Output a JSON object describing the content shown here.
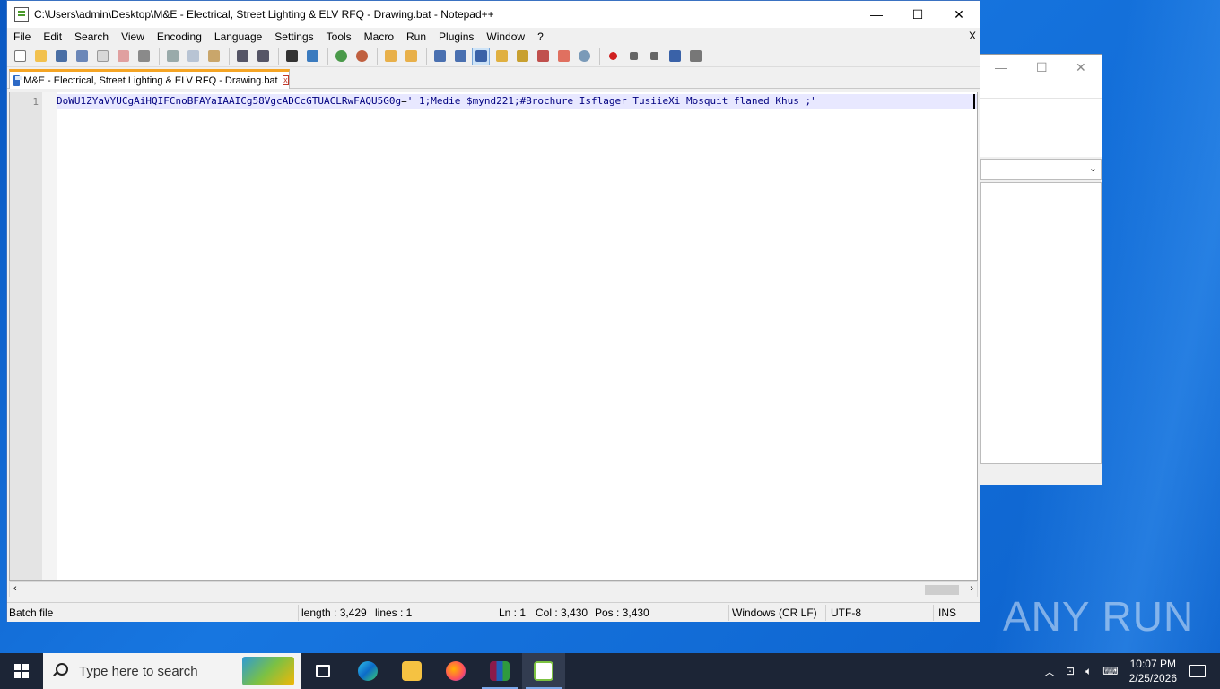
{
  "window": {
    "title": "C:\\Users\\admin\\Desktop\\M&E - Electrical, Street Lighting & ELV RFQ - Drawing.bat - Notepad++",
    "minimize": "—",
    "maximize": "☐",
    "close": "✕"
  },
  "menu": {
    "items": [
      "File",
      "Edit",
      "Search",
      "View",
      "Encoding",
      "Language",
      "Settings",
      "Tools",
      "Macro",
      "Run",
      "Plugins",
      "Window",
      "?"
    ],
    "close_doc": "X"
  },
  "toolbar": {
    "icons": [
      "new-file-icon",
      "open-file-icon",
      "save-icon",
      "save-all-icon",
      "close-icon",
      "close-all-icon",
      "print-icon",
      "cut-icon",
      "copy-icon",
      "paste-icon",
      "undo-icon",
      "redo-icon",
      "find-icon",
      "replace-icon",
      "zoom-in-icon",
      "zoom-out-icon",
      "sync-v-icon",
      "sync-h-icon",
      "word-wrap-icon",
      "show-all-chars-icon",
      "indent-guide-icon",
      "udl-icon",
      "doc-map-icon",
      "function-list-icon",
      "folder-workspace-icon",
      "monitor-icon",
      "record-macro-icon",
      "stop-record-icon",
      "play-macro-icon",
      "run-macro-multiple-icon",
      "save-macro-icon"
    ]
  },
  "tab": {
    "label": "M&E - Electrical, Street Lighting & ELV RFQ - Drawing.bat",
    "close": "x"
  },
  "editor": {
    "line_number": "1",
    "code_before": "DoWU1ZYaVYUCgAiHQIFCnoBFAYaIAAICg58VgcADCcGTUACLRwFAQU5G0g",
    "code_op": "=",
    "code_after": "' 1;Medie $mynd221;#Brochure Isflager TusiieXi Mosquit flaned Khus ;\""
  },
  "status": {
    "type": "Batch file",
    "length": "length : 3,429",
    "lines": "lines : 1",
    "ln": "Ln : 1",
    "col": "Col : 3,430",
    "pos": "Pos : 3,430",
    "eol": "Windows (CR LF)",
    "encoding": "UTF-8",
    "mode": "INS"
  },
  "watermark": "ANY RUN",
  "taskbar": {
    "search_placeholder": "Type here to search",
    "time": "10:07 PM",
    "date": "2/25/2026"
  },
  "colors": {
    "accent_tab": "#f5a524",
    "code_text": "#000080",
    "desktop": "#0b5fc7"
  }
}
